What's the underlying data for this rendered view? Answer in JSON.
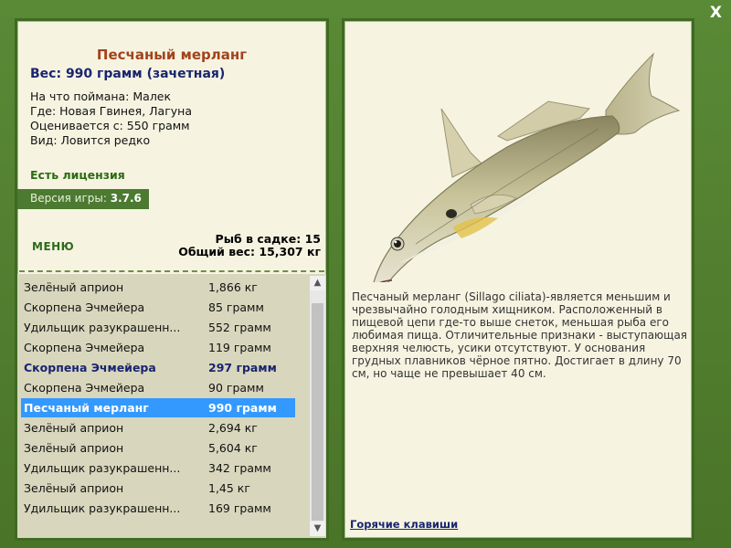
{
  "window": {
    "close_label": "X"
  },
  "fish": {
    "name": "Песчаный мерланг",
    "weight_line": "Вес: 990 грамм (зачетная)",
    "caught_on": "На что поймана: Малек",
    "location": "Где: Новая Гвинея, Лагуна",
    "rated_from": "Оценивается с: 550 грамм",
    "kind": "Вид: Ловится редко",
    "description": "Песчаный мерланг (Sillago ciliata)-является меньшим и чрезвычайно голодным хищником. Расположенный в пищевой цепи где-то выше снеток, меньшая рыба его любимая пища. Отличительные признаки - выступающая верхняя челюсть, усики отсутствуют. У основания грудных плавников чёрное пятно. Достигает в длину 70 см, но чаще не превышает 40 см."
  },
  "license": "Есть лицензия",
  "version": {
    "label": "Версия игры:",
    "value": "3.7.6"
  },
  "menu_label": "МЕНЮ",
  "sadok": {
    "count_line": "Рыб в садке: 15",
    "total_line": "Общий вес: 15,307 кг"
  },
  "catch_list": [
    {
      "name": "Зелёный априон",
      "weight": "1,866 кг",
      "style": "normal"
    },
    {
      "name": "Скорпена Эчмейера",
      "weight": "85 грамм",
      "style": "normal"
    },
    {
      "name": "Удильщик разукрашенн...",
      "weight": "552 грамм",
      "style": "normal"
    },
    {
      "name": "Скорпена Эчмейера",
      "weight": "119 грамм",
      "style": "normal"
    },
    {
      "name": "Скорпена Эчмейера",
      "weight": "297 грамм",
      "style": "bold"
    },
    {
      "name": "Скорпена Эчмейера",
      "weight": "90 грамм",
      "style": "normal"
    },
    {
      "name": "Песчаный мерланг",
      "weight": "990 грамм",
      "style": "selected"
    },
    {
      "name": "Зелёный априон",
      "weight": "2,694 кг",
      "style": "normal"
    },
    {
      "name": "Зелёный априон",
      "weight": "5,604 кг",
      "style": "normal"
    },
    {
      "name": "Удильщик разукрашенн...",
      "weight": "342 грамм",
      "style": "normal"
    },
    {
      "name": "Зелёный априон",
      "weight": "1,45 кг",
      "style": "normal"
    },
    {
      "name": "Удильщик разукрашенн...",
      "weight": "169 грамм",
      "style": "normal"
    }
  ],
  "hotkeys_label": "Горячие клавиши",
  "colors": {
    "frame": "#4e7a2e",
    "panel": "#f6f4e1",
    "title": "#a3421c",
    "selected_row": "#3399ff"
  },
  "icons": {
    "close": "close-icon",
    "scroll_up": "chevron-up-icon",
    "scroll_down": "chevron-down-icon"
  }
}
